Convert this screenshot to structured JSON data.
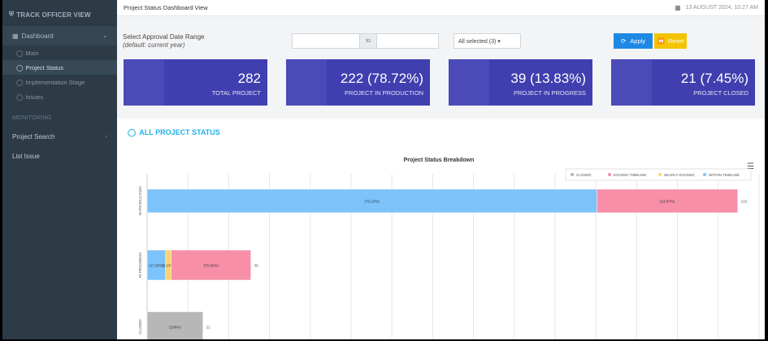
{
  "sidebar": {
    "brand": "TRACK OFFICER VIEW",
    "dashboard_label": "Dashboard",
    "sub_items": [
      {
        "label": "Main"
      },
      {
        "label": "Project Status"
      },
      {
        "label": "Implementation Stage"
      },
      {
        "label": "Issues"
      }
    ],
    "section_label": "MONITORING",
    "items": [
      {
        "label": "Project Search"
      },
      {
        "label": "List Issue"
      }
    ]
  },
  "topbar": {
    "title": "Project Status Dashboard View",
    "datetime": "13 AUGUST 2024, 10:27 AM"
  },
  "filter": {
    "label": "Select Approval Date Range",
    "sublabel": "(default: current year)",
    "to_label": "to",
    "select_value": "All selected (3) ▾",
    "apply_label": "Apply",
    "reset_label": "Reset"
  },
  "cards": [
    {
      "value": "282",
      "label": "TOTAL PROJECT",
      "icon": "grid-icon"
    },
    {
      "value": "222 (78.72%)",
      "label": "PROJECT IN PRODUCTION",
      "icon": "bank-icon"
    },
    {
      "value": "39 (13.83%)",
      "label": "PROJECT IN PROGRESS",
      "icon": "clock-icon"
    },
    {
      "value": "21 (7.45%)",
      "label": "PROJECT CLOSED",
      "icon": "warning-icon"
    }
  ],
  "panel": {
    "title": "ALL PROJECT STATUS"
  },
  "colors": {
    "card": "#3f3fb0",
    "within_timeline": "#7cc3fb",
    "nearly_exceed": "#f9d56e",
    "exceed_timeline": "#f78fa8",
    "closed": "#b7b7b7"
  },
  "chart_data": {
    "type": "bar",
    "orientation": "horizontal",
    "stacked": true,
    "title": "Project Status Breakdown",
    "categories": [
      "IN PRODUCTION",
      "IN PROGRESS",
      "CLOSED"
    ],
    "legend": [
      "CLOSED",
      "EXCEED TIMELINE",
      "NEARLY EXCEED",
      "WITHIN TIMELINE"
    ],
    "legend_position": "top-right",
    "series": [
      {
        "name": "WITHIN TIMELINE",
        "values": [
          169,
          7,
          0
        ],
        "labels": [
          "(76.13%)",
          "(17.95%)",
          ""
        ]
      },
      {
        "name": "NEARLY EXCEED",
        "values": [
          0,
          2,
          0
        ],
        "labels": [
          "",
          "(5.13%)",
          ""
        ]
      },
      {
        "name": "EXCEED TIMELINE",
        "values": [
          53,
          30,
          0
        ],
        "labels": [
          "(23.87%)",
          "(76.92%)",
          ""
        ]
      },
      {
        "name": "CLOSED",
        "values": [
          0,
          0,
          21
        ],
        "labels": [
          "",
          "",
          "(100%)"
        ]
      }
    ],
    "totals": [
      "222",
      "39",
      "21"
    ],
    "xlim": [
      0,
      230
    ],
    "grid": true
  }
}
